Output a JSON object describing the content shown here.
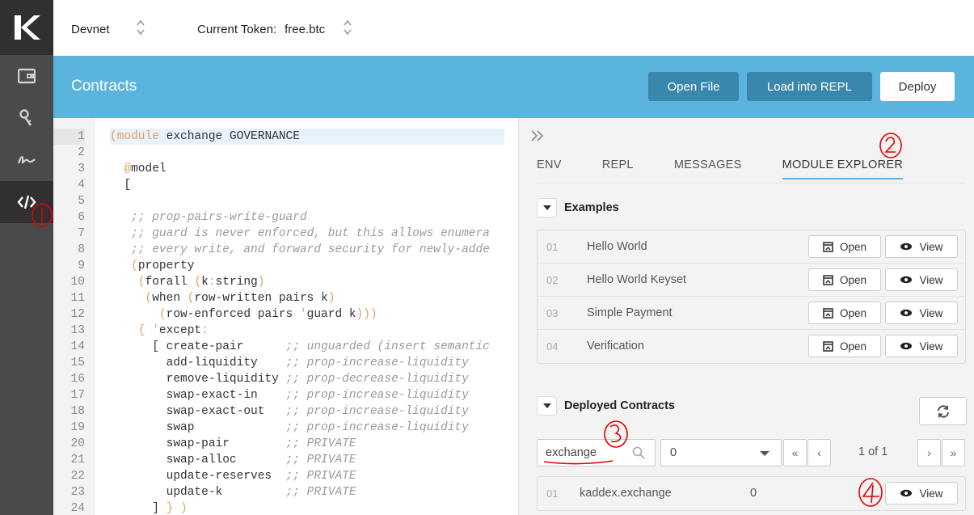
{
  "sidebar": {
    "logo": "K",
    "items": [
      {
        "icon": "wallet-icon",
        "active": false
      },
      {
        "icon": "keys-icon",
        "active": false
      },
      {
        "icon": "signature-icon",
        "active": false
      },
      {
        "icon": "code-icon",
        "active": true
      }
    ]
  },
  "topbar": {
    "network": "Devnet",
    "token_label": "Current Token:",
    "token_value": "free.btc"
  },
  "header": {
    "title": "Contracts",
    "open_file": "Open File",
    "load_repl": "Load into REPL",
    "deploy": "Deploy"
  },
  "editor": {
    "lines": [
      "1",
      "2",
      "3",
      "4",
      "5",
      "6",
      "7",
      "8",
      "9",
      "10",
      "11",
      "12",
      "13",
      "14",
      "15",
      "16",
      "17",
      "18",
      "19",
      "20",
      "21",
      "22",
      "23",
      "24"
    ]
  },
  "panel": {
    "tabs": [
      "ENV",
      "REPL",
      "MESSAGES",
      "MODULE EXPLORER"
    ],
    "active_tab": "MODULE EXPLORER",
    "examples": {
      "title": "Examples",
      "items": [
        {
          "num": "01",
          "name": "Hello World"
        },
        {
          "num": "02",
          "name": "Hello World Keyset"
        },
        {
          "num": "03",
          "name": "Simple Payment"
        },
        {
          "num": "04",
          "name": "Verification"
        }
      ],
      "open_label": "Open",
      "view_label": "View"
    },
    "deployed": {
      "title": "Deployed Contracts",
      "filter_value": "exchange",
      "chain_value": "0",
      "page_text": "1 of 1",
      "items": [
        {
          "num": "01",
          "name": "kaddex.exchange",
          "chain": "0"
        }
      ],
      "view_label": "View"
    }
  },
  "annotations": [
    "1",
    "2",
    "3",
    "4"
  ],
  "colors": {
    "sidebar": "#4a4a4a",
    "header": "#5ab4dd",
    "accent_dark": "#3a87ad",
    "annotation": "#e00000"
  }
}
